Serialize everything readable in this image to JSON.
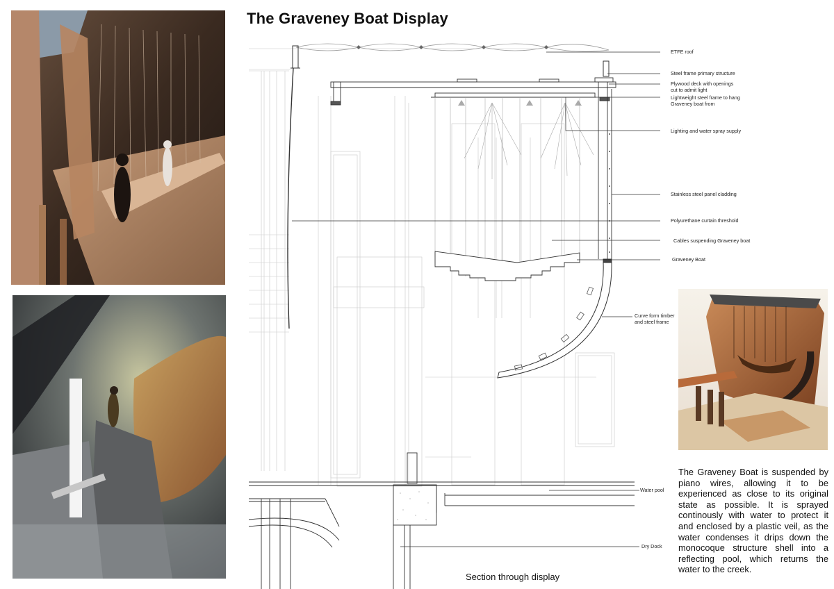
{
  "title": "The Graveney Boat Display",
  "caption": "Section through display",
  "description": "The Graveney Boat is suspended by piano wires, allowing it to be experienced as close to its original state as possible. It is sprayed continously with water to protect it and enclosed by a plastic veil, as the water condenses it drips down the monocoque structure shell into a reflecting pool, which returns the water to the creek.",
  "labels": {
    "etfe_roof": "ETFE roof",
    "steel_frame": "Steel frame primary structure",
    "plywood_1": "Plywood deck with openings",
    "plywood_2": "cut to admit light",
    "lightweight_1": "Lightweight steel frame to hang",
    "lightweight_2": "Graveney boat from",
    "lighting": "Lighting and water spray supply",
    "cladding": "Stainless steel panel cladding",
    "curtain": "Polyurethane curtain threshold",
    "cables": "Cables suspending Graveney boat",
    "boat": "Graveney Boat",
    "curve_1": "Curve form timber",
    "curve_2": "and steel frame",
    "water_pool": "Water pool",
    "dry_dock": "Dry Dock"
  }
}
